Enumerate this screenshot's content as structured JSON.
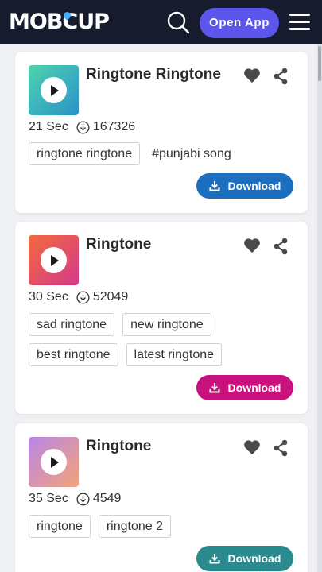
{
  "header": {
    "logo_text": "MOBCUP",
    "open_app_label": "Open App",
    "search_icon": "search-icon",
    "menu_icon": "hamburger-menu-icon"
  },
  "colors": {
    "header_bg": "#171b2e",
    "open_app_bg": "#5b55ec",
    "logo_accent": "#3ab0ff",
    "page_bg": "#eef0f3"
  },
  "ringtones": [
    {
      "title": "Ringtone Ringtone",
      "duration": "21 Sec",
      "downloads": "167326",
      "tags": [
        "ringtone ringtone",
        "#punjabi song"
      ],
      "download_label": "Download",
      "button_color": "#1c6fbf",
      "art_gradient": [
        "#4dd4ae",
        "#2b92c9"
      ]
    },
    {
      "title": "Ringtone",
      "duration": "30 Sec",
      "downloads": "52049",
      "tags": [
        "sad ringtone",
        "new ringtone",
        "best ringtone",
        "latest ringtone"
      ],
      "download_label": "Download",
      "button_color": "#c8117d",
      "art_gradient": [
        "#f06a3c",
        "#d43a8a"
      ]
    },
    {
      "title": "Ringtone",
      "duration": "35 Sec",
      "downloads": "4549",
      "tags": [
        "ringtone",
        "ringtone 2"
      ],
      "download_label": "Download",
      "button_color": "#2a8a8e",
      "art_gradient": [
        "#b886e8",
        "#f3a377"
      ]
    }
  ]
}
